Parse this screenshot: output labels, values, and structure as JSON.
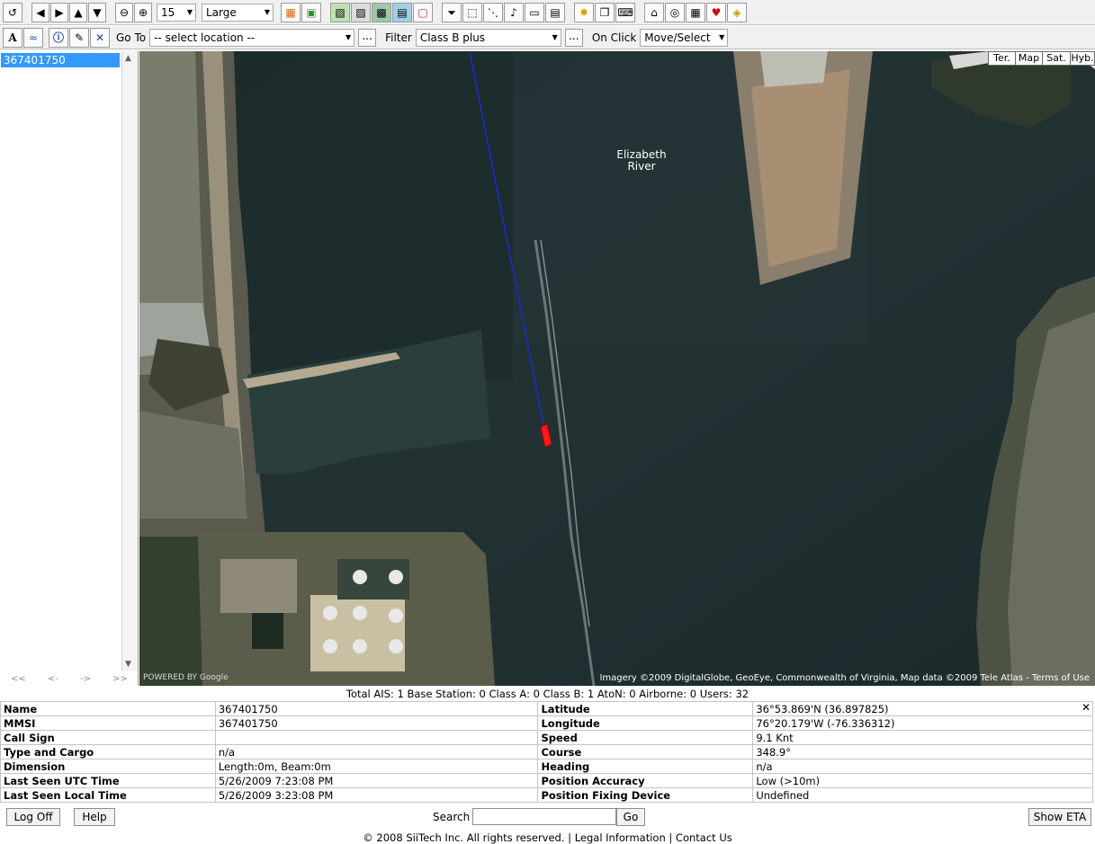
{
  "toolbar": {
    "zoom_value": "15",
    "size_value": "Large"
  },
  "toolbar2": {
    "goto_label": "Go To",
    "goto_value": "-- select location --",
    "goto_more": "...",
    "filter_label": "Filter",
    "filter_value": "Class B plus",
    "filter_more": "...",
    "onclick_label": "On Click",
    "onclick_value": "Move/Select"
  },
  "sidebar": {
    "items": [
      "367401750"
    ],
    "pager": [
      "<<",
      "<-",
      "->",
      ">>"
    ]
  },
  "map": {
    "types": [
      "Ter.",
      "Map",
      "Sat.",
      "Hyb."
    ],
    "place_label_1": "Elizabeth",
    "place_label_2": "River",
    "copyright": "Imagery ©2009 DigitalGlobe, GeoEye, Commonwealth of Virginia, Map data ©2009 Tele Atlas - Terms of Use",
    "powered": "POWERED BY Google"
  },
  "stats": "Total AIS: 1 Base Station: 0 Class A: 0 Class B: 1 AtoN: 0 Airborne: 0 Users: 32",
  "details": [
    {
      "k1": "Name",
      "v1": "367401750",
      "k2": "Latitude",
      "v2": "36°53.869'N (36.897825)"
    },
    {
      "k1": "MMSI",
      "v1": "367401750",
      "k2": "Longitude",
      "v2": "76°20.179'W (-76.336312)"
    },
    {
      "k1": "Call Sign",
      "v1": "",
      "k2": "Speed",
      "v2": "9.1 Knt"
    },
    {
      "k1": "Type and Cargo",
      "v1": "n/a",
      "k2": "Course",
      "v2": "348.9°"
    },
    {
      "k1": "Dimension",
      "v1": "Length:0m, Beam:0m",
      "k2": "Heading",
      "v2": "n/a"
    },
    {
      "k1": "Last Seen UTC Time",
      "v1": "5/26/2009 7:23:08 PM",
      "k2": "Position Accuracy",
      "v2": "Low (>10m)"
    },
    {
      "k1": "Last Seen Local Time",
      "v1": "5/26/2009 3:23:08 PM",
      "k2": "Position Fixing Device",
      "v2": "Undefined"
    }
  ],
  "bottom": {
    "logoff": "Log Off",
    "help": "Help",
    "search_label": "Search",
    "search_value": "",
    "go": "Go",
    "show_eta": "Show ETA"
  },
  "footer": "© 2008 SiiTech Inc. All rights reserved. | Legal Information | Contact Us",
  "colors": {
    "vessel": "#ff1a1a",
    "track": "#1a2bd6",
    "selection": "#3399ff"
  }
}
